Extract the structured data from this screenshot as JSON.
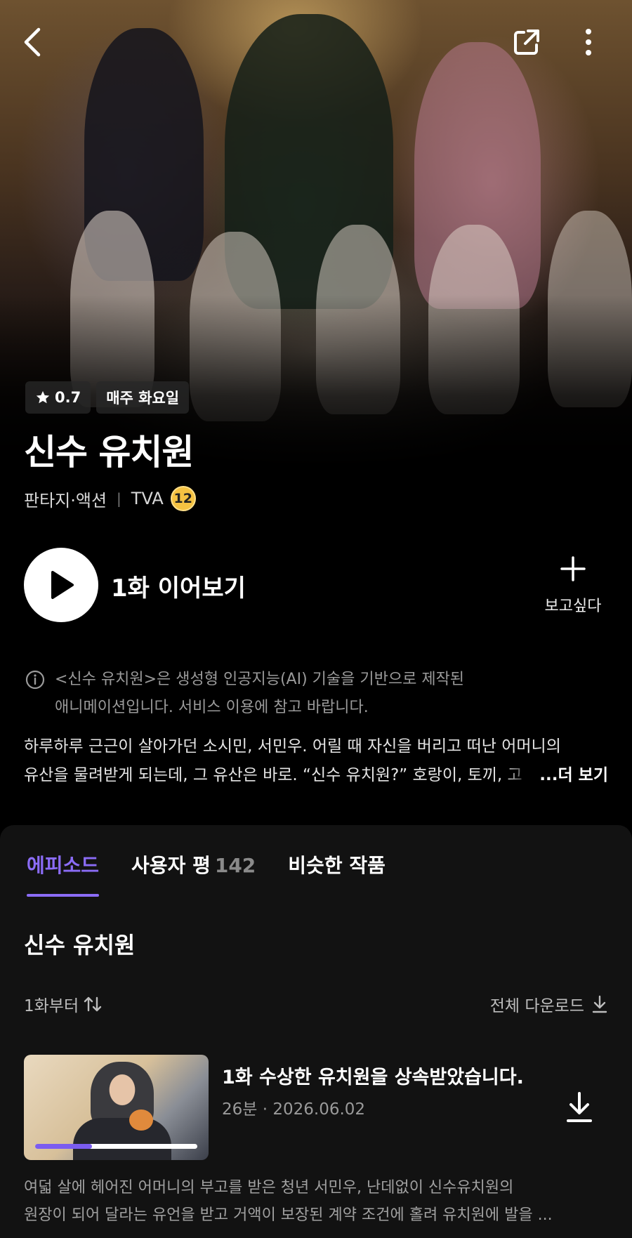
{
  "header": {
    "back_icon": "chevron-left-icon",
    "share_icon": "share-icon",
    "more_icon": "more-vertical-icon"
  },
  "hero": {
    "rating": "0.7",
    "schedule": "매주 화요일",
    "title": "신수 유치원",
    "genre": "판타지·액션",
    "format": "TVA",
    "age_rating": "12"
  },
  "actions": {
    "play_label": "1화 이어보기",
    "wishlist_label": "보고싶다"
  },
  "notice": {
    "line1": "<신수 유치원>은 생성형 인공지능(AI) 기술을 기반으로 제작된",
    "line2": "애니메이션입니다. 서비스 이용에 참고 바랍니다."
  },
  "description": {
    "line1": "하루하루 근근이 살아가던 소시민, 서민우. 어릴 때 자신을 버리고 떠난 어머니의",
    "line2": "유산을 물려받게 되는데, 그 유산은 바로. “신수 유치원?” 호랑이, 토끼, 고",
    "more_label": "...더 보기"
  },
  "tabs": [
    {
      "label": "에피소드",
      "count": ""
    },
    {
      "label": "사용자 평",
      "count": "142"
    },
    {
      "label": "비슷한 작품",
      "count": ""
    }
  ],
  "episodes_section": {
    "series_title": "신수 유치원",
    "sort_label": "1화부터",
    "download_all_label": "전체 다운로드"
  },
  "episode": {
    "title": "1화 수상한 유치원을 상속받았습니다.",
    "meta": "26분 · 2026.06.02",
    "progress": 0.35,
    "desc_line1": "여덟 살에 헤어진 어머니의 부고를 받은 청년 서민우, 난데없이 신수유치원의",
    "desc_line2": "원장이 되어 달라는 유언을 받고 거액이 보장된 계약 조건에 홀려 유치원에 발을 ..."
  },
  "colors": {
    "accent": "#8b6cf6",
    "age_badge": "#f5c242",
    "panel_bg": "#121212"
  }
}
